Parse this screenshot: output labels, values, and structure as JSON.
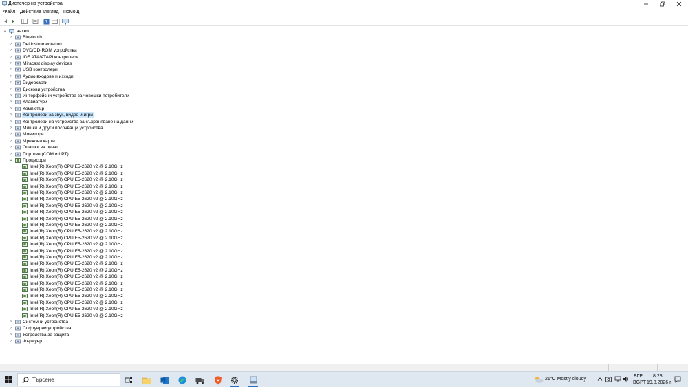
{
  "window": {
    "title": "Диспечер на устройства"
  },
  "menu": {
    "items": [
      "Файл",
      "Действие",
      "Изглед",
      "Помощ"
    ]
  },
  "tree": {
    "root": "aaxen",
    "categories_top": [
      "Bluetooth",
      "DellInstrumentation",
      "DVD/CD-ROM устройства",
      "IDE ATA/ATAPI контролери",
      "Miracast display devices",
      "USB контролери",
      "Аудио входове и изходи",
      "Видеокарти",
      "Дискови устройства",
      "Интерфейсни устройства за човешки потребители",
      "Клавиатури",
      "Компютър",
      "Контролери за звук, видео и игри",
      "Контролери на устройства за съхраняване на данни",
      "Мишки и други посочващи устройства",
      "Монитори",
      "Мрежови карти",
      "Опашки за печат",
      "Портове (COM и LPT)"
    ],
    "selected_category": "Контролери за звук, видео и игри",
    "expanded_category": "Процесори",
    "processor_name": "Intel(R) Xeon(R) CPU E5-2620 v2 @ 2.10GHz",
    "processor_count": 24,
    "categories_bottom": [
      "Системни устройства",
      "Софтуерни устройства",
      "Устройства за защита",
      "Фърмуер"
    ]
  },
  "taskbar": {
    "search_placeholder": "Търсене",
    "weather": "21°C  Mostly cloudy",
    "lang_top": "БГР",
    "lang_bottom": "BGPT",
    "time": "8:23",
    "date": "19.8.2026 г."
  }
}
